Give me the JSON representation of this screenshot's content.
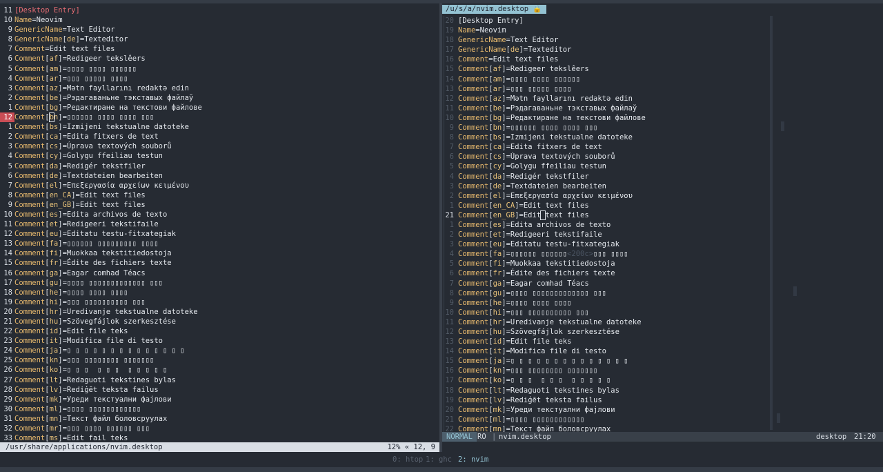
{
  "left_pane": {
    "lines": [
      {
        "ln": "11",
        "kind": "header",
        "text": "[Desktop Entry]"
      },
      {
        "ln": "10",
        "kind": "kv",
        "key": "Name",
        "value": "Neovim"
      },
      {
        "ln": "9",
        "kind": "kv",
        "key": "GenericName",
        "value": "Text Editor"
      },
      {
        "ln": "8",
        "kind": "kvl",
        "key": "GenericName",
        "locale": "de",
        "value": "Texteditor"
      },
      {
        "ln": "7",
        "kind": "kv",
        "key": "Comment",
        "value": "Edit text files"
      },
      {
        "ln": "6",
        "kind": "kvl",
        "key": "Comment",
        "locale": "af",
        "value": "Redigeer tekslêers"
      },
      {
        "ln": "5",
        "kind": "kvl",
        "key": "Comment",
        "locale": "am",
        "value": "▯▯▯▯ ▯▯▯▯ ▯▯▯▯▯▯"
      },
      {
        "ln": "4",
        "kind": "kvl",
        "key": "Comment",
        "locale": "ar",
        "value": "▯▯▯ ▯▯▯▯▯ ▯▯▯▯"
      },
      {
        "ln": "3",
        "kind": "kvl",
        "key": "Comment",
        "locale": "az",
        "value": "Mətn fayllarını redaktə edin"
      },
      {
        "ln": "2",
        "kind": "kvl",
        "key": "Comment",
        "locale": "be",
        "value": "Рэдагаваньне тэкставых файлаў"
      },
      {
        "ln": "1",
        "kind": "kvl",
        "key": "Comment",
        "locale": "bg",
        "value": "Редактиране на текстови файлове"
      },
      {
        "ln": "12",
        "kind": "kvl",
        "key": "Comment",
        "locale": "bn",
        "value": "▯▯▯▯▯▯ ▯▯▯▯ ▯▯▯▯ ▯▯▯",
        "cursor": true
      },
      {
        "ln": "1",
        "kind": "kvl",
        "key": "Comment",
        "locale": "bs",
        "value": "Izmijeni tekstualne datoteke"
      },
      {
        "ln": "2",
        "kind": "kvl",
        "key": "Comment",
        "locale": "ca",
        "value": "Edita fitxers de text"
      },
      {
        "ln": "3",
        "kind": "kvl",
        "key": "Comment",
        "locale": "cs",
        "value": "Úprava textových souborů"
      },
      {
        "ln": "4",
        "kind": "kvl",
        "key": "Comment",
        "locale": "cy",
        "value": "Golygu ffeiliau testun"
      },
      {
        "ln": "5",
        "kind": "kvl",
        "key": "Comment",
        "locale": "da",
        "value": "Redigér tekstfiler"
      },
      {
        "ln": "6",
        "kind": "kvl",
        "key": "Comment",
        "locale": "de",
        "value": "Textdateien bearbeiten"
      },
      {
        "ln": "7",
        "kind": "kvl",
        "key": "Comment",
        "locale": "el",
        "value": "Επεξεργασία αρχείων κειμένου"
      },
      {
        "ln": "8",
        "kind": "kvl",
        "key": "Comment",
        "locale": "en_CA",
        "value": "Edit text files"
      },
      {
        "ln": "9",
        "kind": "kvl",
        "key": "Comment",
        "locale": "en_GB",
        "value": "Edit text files"
      },
      {
        "ln": "10",
        "kind": "kvl",
        "key": "Comment",
        "locale": "es",
        "value": "Edita archivos de texto"
      },
      {
        "ln": "11",
        "kind": "kvl",
        "key": "Comment",
        "locale": "et",
        "value": "Redigeeri tekstifaile"
      },
      {
        "ln": "12",
        "kind": "kvl",
        "key": "Comment",
        "locale": "eu",
        "value": "Editatu testu-fitxategiak"
      },
      {
        "ln": "13",
        "kind": "kvl",
        "key": "Comment",
        "locale": "fa",
        "value": "▯▯▯▯▯▯ ▯▯▯▯▯▯▯▯▯ ▯▯▯▯"
      },
      {
        "ln": "14",
        "kind": "kvl",
        "key": "Comment",
        "locale": "fi",
        "value": "Muokkaa tekstitiedostoja"
      },
      {
        "ln": "15",
        "kind": "kvl",
        "key": "Comment",
        "locale": "fr",
        "value": "Édite des fichiers texte"
      },
      {
        "ln": "16",
        "kind": "kvl",
        "key": "Comment",
        "locale": "ga",
        "value": "Eagar comhad Téacs"
      },
      {
        "ln": "17",
        "kind": "kvl",
        "key": "Comment",
        "locale": "gu",
        "value": "▯▯▯▯ ▯▯▯▯▯▯▯▯▯▯▯▯▯ ▯▯▯"
      },
      {
        "ln": "18",
        "kind": "kvl",
        "key": "Comment",
        "locale": "he",
        "value": "▯▯▯▯ ▯▯▯▯ ▯▯▯▯"
      },
      {
        "ln": "19",
        "kind": "kvl",
        "key": "Comment",
        "locale": "hi",
        "value": "▯▯▯ ▯▯▯▯▯▯▯▯▯▯ ▯▯▯"
      },
      {
        "ln": "20",
        "kind": "kvl",
        "key": "Comment",
        "locale": "hr",
        "value": "Uredivanje tekstualne datoteke"
      },
      {
        "ln": "21",
        "kind": "kvl",
        "key": "Comment",
        "locale": "hu",
        "value": "Szövegfájlok szerkesztése"
      },
      {
        "ln": "22",
        "kind": "kvl",
        "key": "Comment",
        "locale": "id",
        "value": "Edit file teks"
      },
      {
        "ln": "23",
        "kind": "kvl",
        "key": "Comment",
        "locale": "it",
        "value": "Modifica file di testo"
      },
      {
        "ln": "24",
        "kind": "kvl",
        "key": "Comment",
        "locale": "ja",
        "value": "▯ ▯ ▯ ▯ ▯ ▯ ▯ ▯ ▯ ▯ ▯ ▯ ▯ ▯"
      },
      {
        "ln": "25",
        "kind": "kvl",
        "key": "Comment",
        "locale": "kn",
        "value": "▯▯▯ ▯▯▯▯▯▯▯▯ ▯▯▯▯▯▯▯"
      },
      {
        "ln": "26",
        "kind": "kvl",
        "key": "Comment",
        "locale": "ko",
        "value": "▯ ▯ ▯  ▯ ▯ ▯  ▯ ▯ ▯ ▯ ▯"
      },
      {
        "ln": "27",
        "kind": "kvl",
        "key": "Comment",
        "locale": "lt",
        "value": "Redaguoti tekstines bylas"
      },
      {
        "ln": "28",
        "kind": "kvl",
        "key": "Comment",
        "locale": "lv",
        "value": "Rediģēt teksta failus"
      },
      {
        "ln": "29",
        "kind": "kvl",
        "key": "Comment",
        "locale": "mk",
        "value": "Уреди текстуални фајлови"
      },
      {
        "ln": "30",
        "kind": "kvl",
        "key": "Comment",
        "locale": "ml",
        "value": "▯▯▯▯ ▯▯▯▯▯▯▯▯▯▯▯▯"
      },
      {
        "ln": "31",
        "kind": "kvl",
        "key": "Comment",
        "locale": "mn",
        "value": "Текст файл боловсруулах"
      },
      {
        "ln": "32",
        "kind": "kvl",
        "key": "Comment",
        "locale": "mr",
        "value": "▯▯▯ ▯▯▯▯ ▯▯▯▯▯▯ ▯▯▯"
      },
      {
        "ln": "33",
        "kind": "kvl",
        "key": "Comment",
        "locale": "ms",
        "value": "Edit fail teks"
      }
    ],
    "status": {
      "path": "/usr/share/applications/nvim.desktop",
      "position": "12% « 12, 9"
    }
  },
  "right_pane": {
    "tab": "/u/s/a/nvim.desktop 🔒",
    "lines": [
      {
        "ln": "20",
        "kind": "header",
        "text": "[Desktop Entry]"
      },
      {
        "ln": "19",
        "kind": "kv",
        "key": "Name",
        "value": "Neovim"
      },
      {
        "ln": "18",
        "kind": "kv",
        "key": "GenericName",
        "value": "Text Editor"
      },
      {
        "ln": "17",
        "kind": "kvl",
        "key": "GenericName",
        "locale": "de",
        "value": "Texteditor"
      },
      {
        "ln": "16",
        "kind": "kv",
        "key": "Comment",
        "value": "Edit text files"
      },
      {
        "ln": "15",
        "kind": "kvl",
        "key": "Comment",
        "locale": "af",
        "value": "Redigeer tekslêers"
      },
      {
        "ln": "14",
        "kind": "kvl",
        "key": "Comment",
        "locale": "am",
        "value": "▯▯▯▯ ▯▯▯▯ ▯▯▯▯▯▯"
      },
      {
        "ln": "13",
        "kind": "kvl",
        "key": "Comment",
        "locale": "ar",
        "value": "▯▯▯ ▯▯▯▯▯ ▯▯▯▯"
      },
      {
        "ln": "12",
        "kind": "kvl",
        "key": "Comment",
        "locale": "az",
        "value": "Mətn fayllarını redaktə edin"
      },
      {
        "ln": "11",
        "kind": "kvl",
        "key": "Comment",
        "locale": "be",
        "value": "Рэдагаваньне тэкставых файлаў"
      },
      {
        "ln": "10",
        "kind": "kvl",
        "key": "Comment",
        "locale": "bg",
        "value": "Редактиране на текстови файлове"
      },
      {
        "ln": "9",
        "kind": "kvl",
        "key": "Comment",
        "locale": "bn",
        "value": "▯▯▯▯▯▯ ▯▯▯▯ ▯▯▯▯ ▯▯▯"
      },
      {
        "ln": "8",
        "kind": "kvl",
        "key": "Comment",
        "locale": "bs",
        "value": "Izmijeni tekstualne datoteke"
      },
      {
        "ln": "7",
        "kind": "kvl",
        "key": "Comment",
        "locale": "ca",
        "value": "Edita fitxers de text"
      },
      {
        "ln": "6",
        "kind": "kvl",
        "key": "Comment",
        "locale": "cs",
        "value": "Úprava textových souborů"
      },
      {
        "ln": "5",
        "kind": "kvl",
        "key": "Comment",
        "locale": "cy",
        "value": "Golygu ffeiliau testun"
      },
      {
        "ln": "4",
        "kind": "kvl",
        "key": "Comment",
        "locale": "da",
        "value": "Redigér tekstfiler"
      },
      {
        "ln": "3",
        "kind": "kvl",
        "key": "Comment",
        "locale": "de",
        "value": "Textdateien bearbeiten"
      },
      {
        "ln": "2",
        "kind": "kvl",
        "key": "Comment",
        "locale": "el",
        "value": "Επεξεργασία αρχείων κειμένου"
      },
      {
        "ln": "1",
        "kind": "kvl",
        "key": "Comment",
        "locale": "en_CA",
        "value": "Edit text files"
      },
      {
        "ln": "21",
        "kind": "kvl",
        "key": "Comment",
        "locale": "en_GB",
        "value": "Edit text files",
        "current": true,
        "cursor_split": [
          "Edit",
          " ",
          "text files"
        ]
      },
      {
        "ln": "1",
        "kind": "kvl",
        "key": "Comment",
        "locale": "es",
        "value": "Edita archivos de texto"
      },
      {
        "ln": "2",
        "kind": "kvl",
        "key": "Comment",
        "locale": "et",
        "value": "Redigeeri tekstifaile"
      },
      {
        "ln": "3",
        "kind": "kvl",
        "key": "Comment",
        "locale": "eu",
        "value": "Editatu testu-fitxategiak"
      },
      {
        "ln": "4",
        "kind": "kvl",
        "key": "Comment",
        "locale": "fa",
        "value": "▯▯▯▯▯▯ ▯▯▯▯▯▯",
        "virt": "<200c>",
        "tail": "▯▯▯ ▯▯▯▯"
      },
      {
        "ln": "5",
        "kind": "kvl",
        "key": "Comment",
        "locale": "fi",
        "value": "Muokkaa tekstitiedostoja"
      },
      {
        "ln": "6",
        "kind": "kvl",
        "key": "Comment",
        "locale": "fr",
        "value": "Édite des fichiers texte"
      },
      {
        "ln": "7",
        "kind": "kvl",
        "key": "Comment",
        "locale": "ga",
        "value": "Eagar comhad Téacs"
      },
      {
        "ln": "8",
        "kind": "kvl",
        "key": "Comment",
        "locale": "gu",
        "value": "▯▯▯▯ ▯▯▯▯▯▯▯▯▯▯▯▯▯ ▯▯▯"
      },
      {
        "ln": "9",
        "kind": "kvl",
        "key": "Comment",
        "locale": "he",
        "value": "▯▯▯▯ ▯▯▯▯ ▯▯▯▯"
      },
      {
        "ln": "10",
        "kind": "kvl",
        "key": "Comment",
        "locale": "hi",
        "value": "▯▯▯ ▯▯▯▯▯▯▯▯▯▯ ▯▯▯"
      },
      {
        "ln": "11",
        "kind": "kvl",
        "key": "Comment",
        "locale": "hr",
        "value": "Uredivanje tekstualne datoteke"
      },
      {
        "ln": "12",
        "kind": "kvl",
        "key": "Comment",
        "locale": "hu",
        "value": "Szövegfájlok szerkesztése"
      },
      {
        "ln": "13",
        "kind": "kvl",
        "key": "Comment",
        "locale": "id",
        "value": "Edit file teks"
      },
      {
        "ln": "14",
        "kind": "kvl",
        "key": "Comment",
        "locale": "it",
        "value": "Modifica file di testo"
      },
      {
        "ln": "15",
        "kind": "kvl",
        "key": "Comment",
        "locale": "ja",
        "value": "▯ ▯ ▯ ▯ ▯ ▯ ▯ ▯ ▯ ▯ ▯ ▯ ▯ ▯"
      },
      {
        "ln": "16",
        "kind": "kvl",
        "key": "Comment",
        "locale": "kn",
        "value": "▯▯▯ ▯▯▯▯▯▯▯▯ ▯▯▯▯▯▯▯"
      },
      {
        "ln": "17",
        "kind": "kvl",
        "key": "Comment",
        "locale": "ko",
        "value": "▯ ▯ ▯  ▯ ▯ ▯  ▯ ▯ ▯ ▯ ▯"
      },
      {
        "ln": "18",
        "kind": "kvl",
        "key": "Comment",
        "locale": "lt",
        "value": "Redaguoti tekstines bylas"
      },
      {
        "ln": "19",
        "kind": "kvl",
        "key": "Comment",
        "locale": "lv",
        "value": "Rediģēt teksta failus"
      },
      {
        "ln": "20",
        "kind": "kvl",
        "key": "Comment",
        "locale": "mk",
        "value": "Уреди текстуални фајлови"
      },
      {
        "ln": "21",
        "kind": "kvl",
        "key": "Comment",
        "locale": "ml",
        "value": "▯▯▯▯ ▯▯▯▯▯▯▯▯▯▯▯▯"
      },
      {
        "ln": "22",
        "kind": "kvl",
        "key": "Comment",
        "locale": "mn",
        "value": "Текст файл боловсруулах"
      }
    ],
    "status": {
      "mode": "NORMAL",
      "readonly": "RO",
      "separator": "|",
      "filename": "nvim.desktop",
      "filetype": "desktop",
      "position": "21:20"
    }
  },
  "tmux": {
    "windows": [
      {
        "label": "0: htop",
        "active": false
      },
      {
        "label": "1: ghc",
        "active": false
      },
      {
        "label": "2: nvim",
        "active": true
      }
    ]
  }
}
